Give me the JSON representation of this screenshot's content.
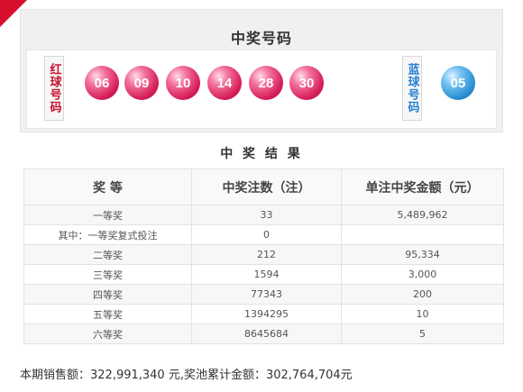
{
  "header": {
    "title": "中奖号码"
  },
  "red_label": "红球号码",
  "blue_label": "蓝球号码",
  "red_balls": [
    "06",
    "09",
    "10",
    "14",
    "28",
    "30"
  ],
  "blue_balls": [
    "05"
  ],
  "results": {
    "title": "中 奖 结 果",
    "columns": [
      "奖  等",
      "中奖注数（注）",
      "单注中奖金额（元）"
    ],
    "rows": [
      {
        "prize": "一等奖",
        "count": "33",
        "amount": "5,489,962"
      },
      {
        "prize": "其中：一等奖复式投注",
        "count": "0",
        "amount": ""
      },
      {
        "prize": "二等奖",
        "count": "212",
        "amount": "95,334"
      },
      {
        "prize": "三等奖",
        "count": "1594",
        "amount": "3,000"
      },
      {
        "prize": "四等奖",
        "count": "77343",
        "amount": "200"
      },
      {
        "prize": "五等奖",
        "count": "1394295",
        "amount": "10"
      },
      {
        "prize": "六等奖",
        "count": "8645684",
        "amount": "5"
      }
    ]
  },
  "footer": {
    "summary": "本期销售额：322,991,340 元,奖池累计金额：302,764,704元"
  },
  "colors": {
    "red_ball": "#d61f59",
    "blue_ball": "#2a8fd4",
    "red_text": "#c8102e",
    "blue_text": "#2a7fd1",
    "corner": "#d8102e"
  }
}
